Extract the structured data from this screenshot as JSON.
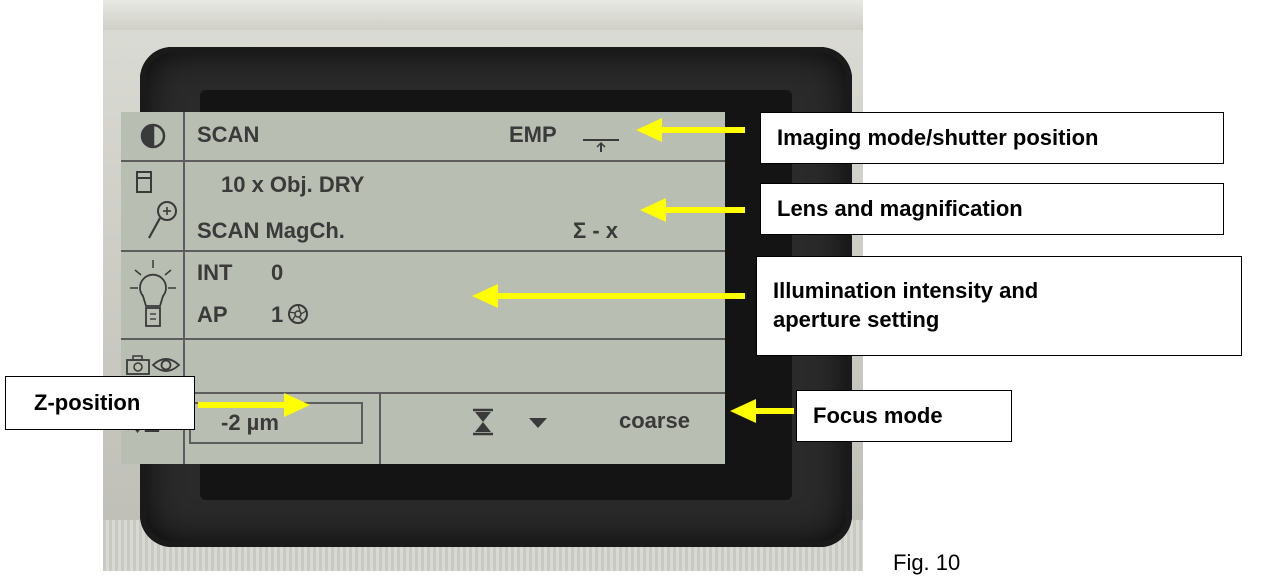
{
  "lcd": {
    "mode_label": "SCAN",
    "shutter_label": "EMP",
    "objective_label": "10 x Obj. DRY",
    "magchange_label": "SCAN MagCh.",
    "sigma_label": "Σ - x",
    "intensity_label": "INT",
    "intensity_value": "0",
    "aperture_label": "AP",
    "aperture_value": "1",
    "z_icon_label": "↕Z",
    "z_value": "-2 µm",
    "focus_label": "coarse",
    "icons": [
      "contrast-icon",
      "objective-icon",
      "magnifier-icon",
      "bulb-icon",
      "camera-icon",
      "eye-icon",
      "hourglass-icon",
      "triangle-down-icon",
      "aperture-icon"
    ]
  },
  "annotations": {
    "imaging_mode": "Imaging mode/shutter position",
    "lens_magnification": "Lens and magnification",
    "illumination_line1": "Illumination intensity and",
    "illumination_line2": "aperture setting",
    "z_position": "Z-position",
    "focus_mode": "Focus mode"
  },
  "caption": "Fig. 10",
  "colors": {
    "arrow": "#ffff00",
    "lcd_background": "#b9beb3",
    "lcd_text": "#3a3a3a",
    "bezel": "#2a2a2a"
  }
}
